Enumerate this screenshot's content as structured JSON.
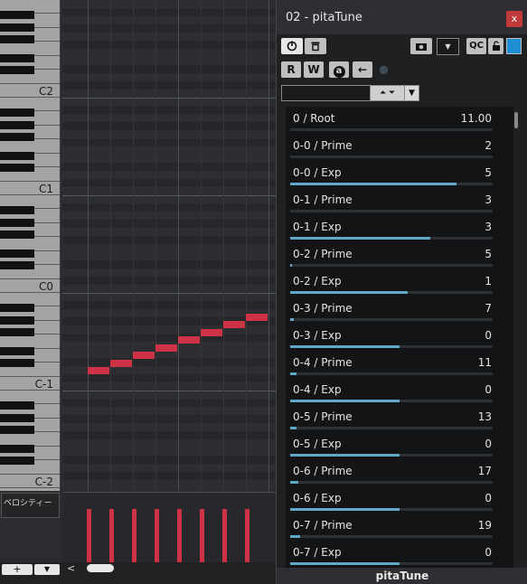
{
  "piano": {
    "octave_labels": [
      "C2",
      "C1",
      "C0",
      "C-1",
      "C-2"
    ]
  },
  "velocity": {
    "label": "ベロシティー",
    "values": [
      1,
      1,
      1,
      1,
      1,
      1,
      1,
      1
    ]
  },
  "bottom_bar": {
    "add_label": "+",
    "menu_label": "▼",
    "left_label": "<"
  },
  "plugin": {
    "title": "02 - pitaTune",
    "close_label": "x",
    "read_label": "R",
    "write_label": "W",
    "auto_label": "a",
    "arrow_label": "←",
    "qc_label": "QC",
    "footer": "pitaTune",
    "params": [
      {
        "name": "0 / Root",
        "value": "11.00",
        "fill": 0
      },
      {
        "name": "0-0 / Prime",
        "value": "2",
        "fill": 0
      },
      {
        "name": "0-0 / Exp",
        "value": "5",
        "fill": 0.82
      },
      {
        "name": "0-1 / Prime",
        "value": "3",
        "fill": 0
      },
      {
        "name": "0-1 / Exp",
        "value": "3",
        "fill": 0.69
      },
      {
        "name": "0-2 / Prime",
        "value": "5",
        "fill": 0.01
      },
      {
        "name": "0-2 / Exp",
        "value": "1",
        "fill": 0.58
      },
      {
        "name": "0-3 / Prime",
        "value": "7",
        "fill": 0.02
      },
      {
        "name": "0-3 / Exp",
        "value": "0",
        "fill": 0.54
      },
      {
        "name": "0-4 / Prime",
        "value": "11",
        "fill": 0.03
      },
      {
        "name": "0-4 / Exp",
        "value": "0",
        "fill": 0.54
      },
      {
        "name": "0-5 / Prime",
        "value": "13",
        "fill": 0.03
      },
      {
        "name": "0-5 / Exp",
        "value": "0",
        "fill": 0.54
      },
      {
        "name": "0-6 / Prime",
        "value": "17",
        "fill": 0.04
      },
      {
        "name": "0-6 / Exp",
        "value": "0",
        "fill": 0.54
      },
      {
        "name": "0-7 / Prime",
        "value": "19",
        "fill": 0.05
      },
      {
        "name": "0-7 / Exp",
        "value": "0",
        "fill": 0.54
      }
    ]
  }
}
